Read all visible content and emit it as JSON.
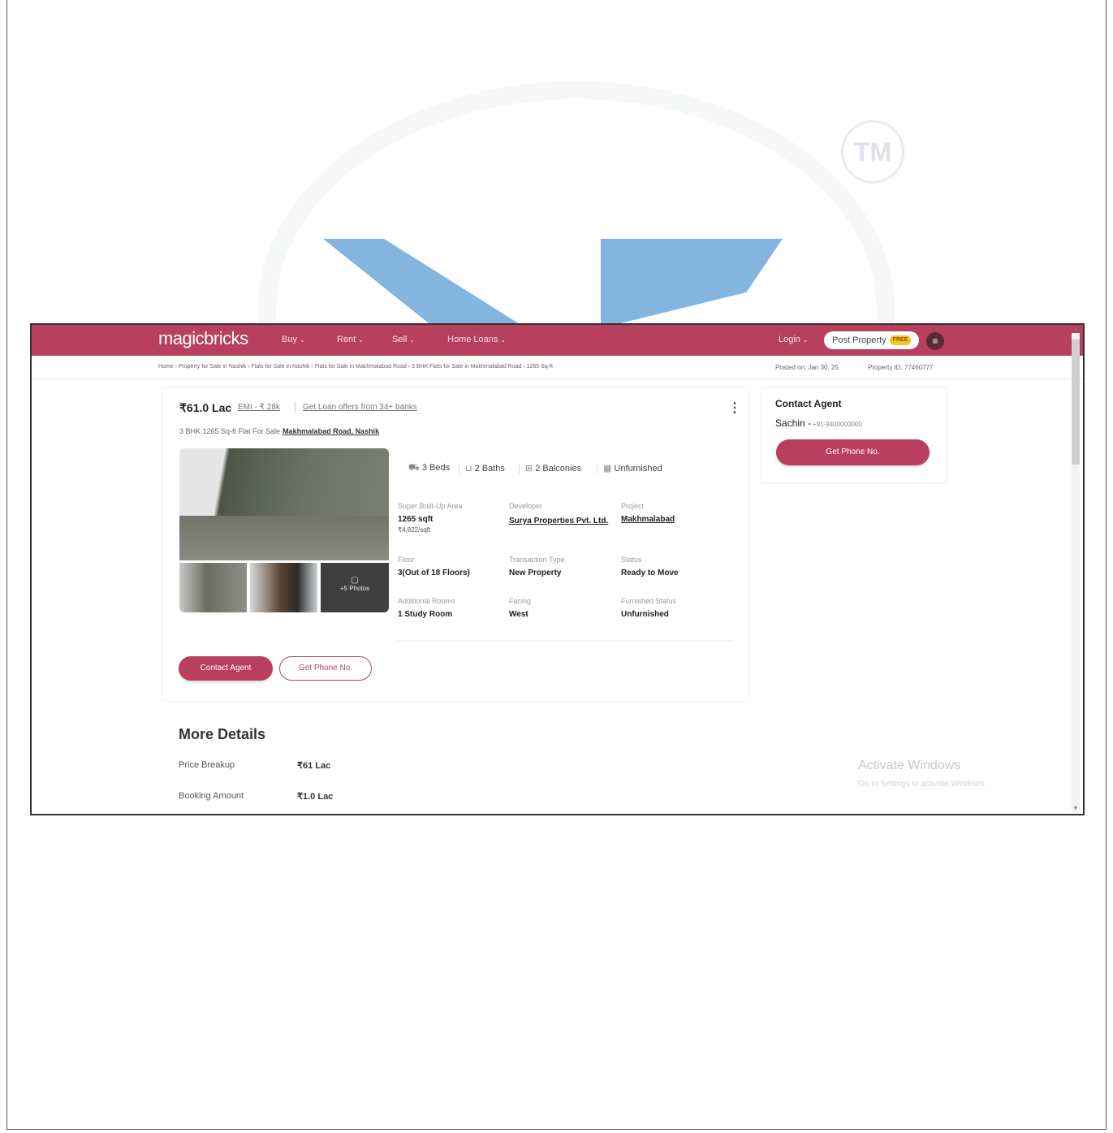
{
  "watermark": {
    "tm_text": "TM"
  },
  "nav": {
    "logo": "magicbricks",
    "items": [
      {
        "label": "Buy"
      },
      {
        "label": "Rent"
      },
      {
        "label": "Sell"
      },
      {
        "label": "Home Loans"
      }
    ],
    "login": "Login",
    "post_property": "Post Property",
    "post_badge": "FREE",
    "menu_icon": "hamburger-icon",
    "brand_color": "#b8405e"
  },
  "breadcrumb": {
    "text": "Home › Property for Sale in Nashik › Flats for Sale in Nashik › Flats for Sale in Makhmalabad Road › 3 BHK Flats for Sale in Makhmalabad Road › 1265 Sq-ft",
    "posted": "Posted on: Jan 30, 25",
    "property_id": "Property ID: 77460777"
  },
  "listing": {
    "price": "₹61.0 Lac",
    "emi": "EMI - ₹ 28k",
    "loan_offers": "Get Loan offers from 34+ banks",
    "subtitle": "3 BHK 1265 Sq-ft Flat For Sale",
    "location": "Makhmalabad Road, Nashik",
    "features": [
      {
        "icon": "bed-icon",
        "label": "3 Beds"
      },
      {
        "icon": "bath-icon",
        "label": "2 Baths"
      },
      {
        "icon": "balcony-icon",
        "label": "2 Balconies"
      },
      {
        "icon": "furnish-icon",
        "label": "Unfurnished"
      }
    ],
    "photos_more": "+5 Photos",
    "details": {
      "area_label": "Super Built-Up Area",
      "area_value": "1265 sqft",
      "area_rate": "₹4,822/sqft",
      "developer_label": "Developer",
      "developer_value": "Surya Properties Pvt. Ltd.",
      "project_label": "Project",
      "project_value": "Makhmalabad",
      "floor_label": "Floor",
      "floor_value": "3(Out of 18 Floors)",
      "transaction_label": "Transaction Type",
      "transaction_value": "New Property",
      "status_label": "Status",
      "status_value": "Ready to Move",
      "rooms_label": "Additional Rooms",
      "rooms_value": "1 Study Room",
      "facing_label": "Facing",
      "facing_value": "West",
      "furnished_label": "Furnished Status",
      "furnished_value": "Unfurnished"
    },
    "contact_button": "Contact Agent",
    "phone_button": "Get Phone No."
  },
  "sidebar": {
    "title": "Contact Agent",
    "agent_name": "Sachin",
    "agent_phone": "+91-9400000000",
    "button": "Get Phone No."
  },
  "more_details": {
    "title": "More Details",
    "rows": [
      {
        "label": "Price Breakup",
        "value": "₹61 Lac"
      },
      {
        "label": "Booking Amount",
        "value": "₹1.0 Lac"
      }
    ]
  },
  "windows": {
    "activate": "Activate Windows",
    "activate_sub": "Go to Settings to activate Windows."
  }
}
